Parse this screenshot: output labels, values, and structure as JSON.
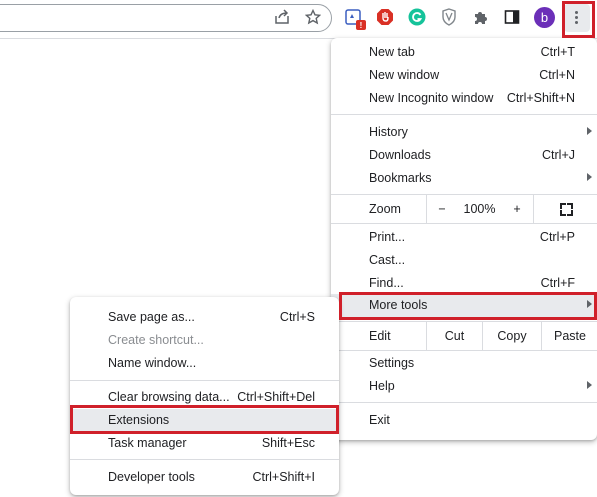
{
  "toolbar": {
    "icons": [
      "share-icon",
      "bookmark-star-icon",
      "extension-badge-icon",
      "adblock-icon",
      "grammarly-icon",
      "shield-icon",
      "puzzle-extensions-icon",
      "side-panel-icon",
      "profile-avatar",
      "kebab-menu-icon"
    ],
    "avatar_letter": "b",
    "badge_text": "!"
  },
  "main_menu": {
    "new_tab": {
      "label": "New tab",
      "shortcut": "Ctrl+T"
    },
    "new_window": {
      "label": "New window",
      "shortcut": "Ctrl+N"
    },
    "new_incognito": {
      "label": "New Incognito window",
      "shortcut": "Ctrl+Shift+N"
    },
    "history": {
      "label": "History"
    },
    "downloads": {
      "label": "Downloads",
      "shortcut": "Ctrl+J"
    },
    "bookmarks": {
      "label": "Bookmarks"
    },
    "zoom": {
      "label": "Zoom",
      "minus": "−",
      "value": "100%",
      "plus": "+"
    },
    "print": {
      "label": "Print...",
      "shortcut": "Ctrl+P"
    },
    "cast": {
      "label": "Cast..."
    },
    "find": {
      "label": "Find...",
      "shortcut": "Ctrl+F"
    },
    "more_tools": {
      "label": "More tools"
    },
    "edit": {
      "label": "Edit",
      "cut": "Cut",
      "copy": "Copy",
      "paste": "Paste"
    },
    "settings": {
      "label": "Settings"
    },
    "help": {
      "label": "Help"
    },
    "exit": {
      "label": "Exit"
    }
  },
  "sub_menu": {
    "save_page": {
      "label": "Save page as...",
      "shortcut": "Ctrl+S"
    },
    "create_shortcut": {
      "label": "Create shortcut..."
    },
    "name_window": {
      "label": "Name window..."
    },
    "clear_browsing": {
      "label": "Clear browsing data...",
      "shortcut": "Ctrl+Shift+Del"
    },
    "extensions": {
      "label": "Extensions"
    },
    "task_manager": {
      "label": "Task manager",
      "shortcut": "Shift+Esc"
    },
    "developer_tools": {
      "label": "Developer tools",
      "shortcut": "Ctrl+Shift+I"
    }
  },
  "colors": {
    "highlight": "#d0202a",
    "avatar": "#6b2fb8",
    "hover": "#e8eaed",
    "grammarly": "#15c39a",
    "adblock": "#d93025"
  }
}
